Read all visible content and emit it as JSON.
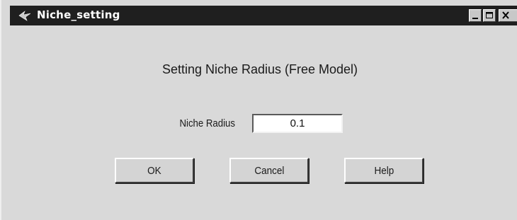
{
  "window": {
    "title": "Niche_setting"
  },
  "dialog": {
    "heading": "Setting Niche Radius (Free Model)",
    "field_label": "Niche Radius",
    "field_value": "0.1"
  },
  "buttons": {
    "ok": "OK",
    "cancel": "Cancel",
    "help": "Help"
  },
  "icons": {
    "app": "matlab-figure-icon",
    "minimize": "minimize-icon",
    "maximize": "maximize-icon",
    "close": "close-icon"
  },
  "colors": {
    "titlebar": "#1f1f1f",
    "dialog_bg": "#d9d9d9",
    "input_bg": "#ffffff"
  }
}
